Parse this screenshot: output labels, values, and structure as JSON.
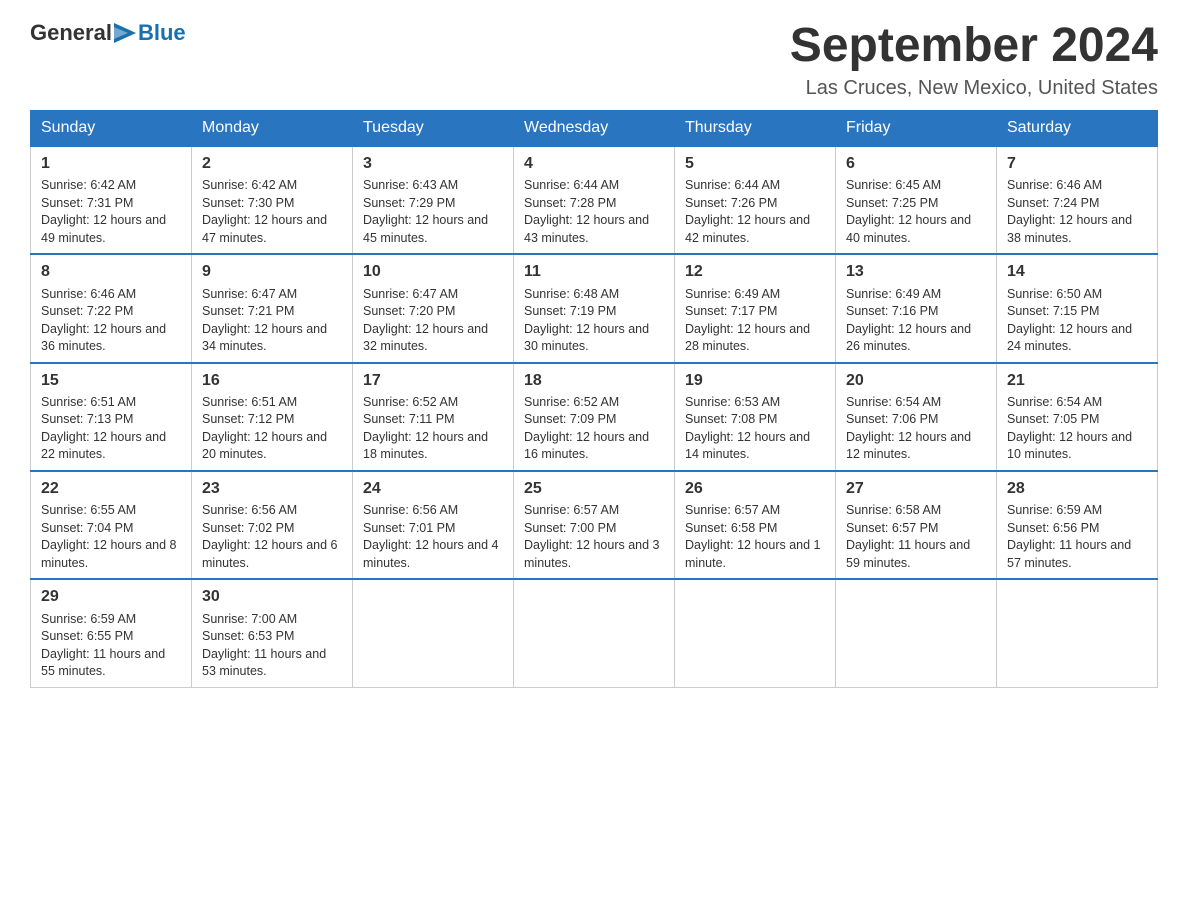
{
  "logo": {
    "general_text": "General",
    "blue_text": "Blue"
  },
  "title": "September 2024",
  "location": "Las Cruces, New Mexico, United States",
  "days_of_week": [
    "Sunday",
    "Monday",
    "Tuesday",
    "Wednesday",
    "Thursday",
    "Friday",
    "Saturday"
  ],
  "weeks": [
    [
      {
        "day": "1",
        "sunrise": "Sunrise: 6:42 AM",
        "sunset": "Sunset: 7:31 PM",
        "daylight": "Daylight: 12 hours and 49 minutes."
      },
      {
        "day": "2",
        "sunrise": "Sunrise: 6:42 AM",
        "sunset": "Sunset: 7:30 PM",
        "daylight": "Daylight: 12 hours and 47 minutes."
      },
      {
        "day": "3",
        "sunrise": "Sunrise: 6:43 AM",
        "sunset": "Sunset: 7:29 PM",
        "daylight": "Daylight: 12 hours and 45 minutes."
      },
      {
        "day": "4",
        "sunrise": "Sunrise: 6:44 AM",
        "sunset": "Sunset: 7:28 PM",
        "daylight": "Daylight: 12 hours and 43 minutes."
      },
      {
        "day": "5",
        "sunrise": "Sunrise: 6:44 AM",
        "sunset": "Sunset: 7:26 PM",
        "daylight": "Daylight: 12 hours and 42 minutes."
      },
      {
        "day": "6",
        "sunrise": "Sunrise: 6:45 AM",
        "sunset": "Sunset: 7:25 PM",
        "daylight": "Daylight: 12 hours and 40 minutes."
      },
      {
        "day": "7",
        "sunrise": "Sunrise: 6:46 AM",
        "sunset": "Sunset: 7:24 PM",
        "daylight": "Daylight: 12 hours and 38 minutes."
      }
    ],
    [
      {
        "day": "8",
        "sunrise": "Sunrise: 6:46 AM",
        "sunset": "Sunset: 7:22 PM",
        "daylight": "Daylight: 12 hours and 36 minutes."
      },
      {
        "day": "9",
        "sunrise": "Sunrise: 6:47 AM",
        "sunset": "Sunset: 7:21 PM",
        "daylight": "Daylight: 12 hours and 34 minutes."
      },
      {
        "day": "10",
        "sunrise": "Sunrise: 6:47 AM",
        "sunset": "Sunset: 7:20 PM",
        "daylight": "Daylight: 12 hours and 32 minutes."
      },
      {
        "day": "11",
        "sunrise": "Sunrise: 6:48 AM",
        "sunset": "Sunset: 7:19 PM",
        "daylight": "Daylight: 12 hours and 30 minutes."
      },
      {
        "day": "12",
        "sunrise": "Sunrise: 6:49 AM",
        "sunset": "Sunset: 7:17 PM",
        "daylight": "Daylight: 12 hours and 28 minutes."
      },
      {
        "day": "13",
        "sunrise": "Sunrise: 6:49 AM",
        "sunset": "Sunset: 7:16 PM",
        "daylight": "Daylight: 12 hours and 26 minutes."
      },
      {
        "day": "14",
        "sunrise": "Sunrise: 6:50 AM",
        "sunset": "Sunset: 7:15 PM",
        "daylight": "Daylight: 12 hours and 24 minutes."
      }
    ],
    [
      {
        "day": "15",
        "sunrise": "Sunrise: 6:51 AM",
        "sunset": "Sunset: 7:13 PM",
        "daylight": "Daylight: 12 hours and 22 minutes."
      },
      {
        "day": "16",
        "sunrise": "Sunrise: 6:51 AM",
        "sunset": "Sunset: 7:12 PM",
        "daylight": "Daylight: 12 hours and 20 minutes."
      },
      {
        "day": "17",
        "sunrise": "Sunrise: 6:52 AM",
        "sunset": "Sunset: 7:11 PM",
        "daylight": "Daylight: 12 hours and 18 minutes."
      },
      {
        "day": "18",
        "sunrise": "Sunrise: 6:52 AM",
        "sunset": "Sunset: 7:09 PM",
        "daylight": "Daylight: 12 hours and 16 minutes."
      },
      {
        "day": "19",
        "sunrise": "Sunrise: 6:53 AM",
        "sunset": "Sunset: 7:08 PM",
        "daylight": "Daylight: 12 hours and 14 minutes."
      },
      {
        "day": "20",
        "sunrise": "Sunrise: 6:54 AM",
        "sunset": "Sunset: 7:06 PM",
        "daylight": "Daylight: 12 hours and 12 minutes."
      },
      {
        "day": "21",
        "sunrise": "Sunrise: 6:54 AM",
        "sunset": "Sunset: 7:05 PM",
        "daylight": "Daylight: 12 hours and 10 minutes."
      }
    ],
    [
      {
        "day": "22",
        "sunrise": "Sunrise: 6:55 AM",
        "sunset": "Sunset: 7:04 PM",
        "daylight": "Daylight: 12 hours and 8 minutes."
      },
      {
        "day": "23",
        "sunrise": "Sunrise: 6:56 AM",
        "sunset": "Sunset: 7:02 PM",
        "daylight": "Daylight: 12 hours and 6 minutes."
      },
      {
        "day": "24",
        "sunrise": "Sunrise: 6:56 AM",
        "sunset": "Sunset: 7:01 PM",
        "daylight": "Daylight: 12 hours and 4 minutes."
      },
      {
        "day": "25",
        "sunrise": "Sunrise: 6:57 AM",
        "sunset": "Sunset: 7:00 PM",
        "daylight": "Daylight: 12 hours and 3 minutes."
      },
      {
        "day": "26",
        "sunrise": "Sunrise: 6:57 AM",
        "sunset": "Sunset: 6:58 PM",
        "daylight": "Daylight: 12 hours and 1 minute."
      },
      {
        "day": "27",
        "sunrise": "Sunrise: 6:58 AM",
        "sunset": "Sunset: 6:57 PM",
        "daylight": "Daylight: 11 hours and 59 minutes."
      },
      {
        "day": "28",
        "sunrise": "Sunrise: 6:59 AM",
        "sunset": "Sunset: 6:56 PM",
        "daylight": "Daylight: 11 hours and 57 minutes."
      }
    ],
    [
      {
        "day": "29",
        "sunrise": "Sunrise: 6:59 AM",
        "sunset": "Sunset: 6:55 PM",
        "daylight": "Daylight: 11 hours and 55 minutes."
      },
      {
        "day": "30",
        "sunrise": "Sunrise: 7:00 AM",
        "sunset": "Sunset: 6:53 PM",
        "daylight": "Daylight: 11 hours and 53 minutes."
      },
      null,
      null,
      null,
      null,
      null
    ]
  ]
}
